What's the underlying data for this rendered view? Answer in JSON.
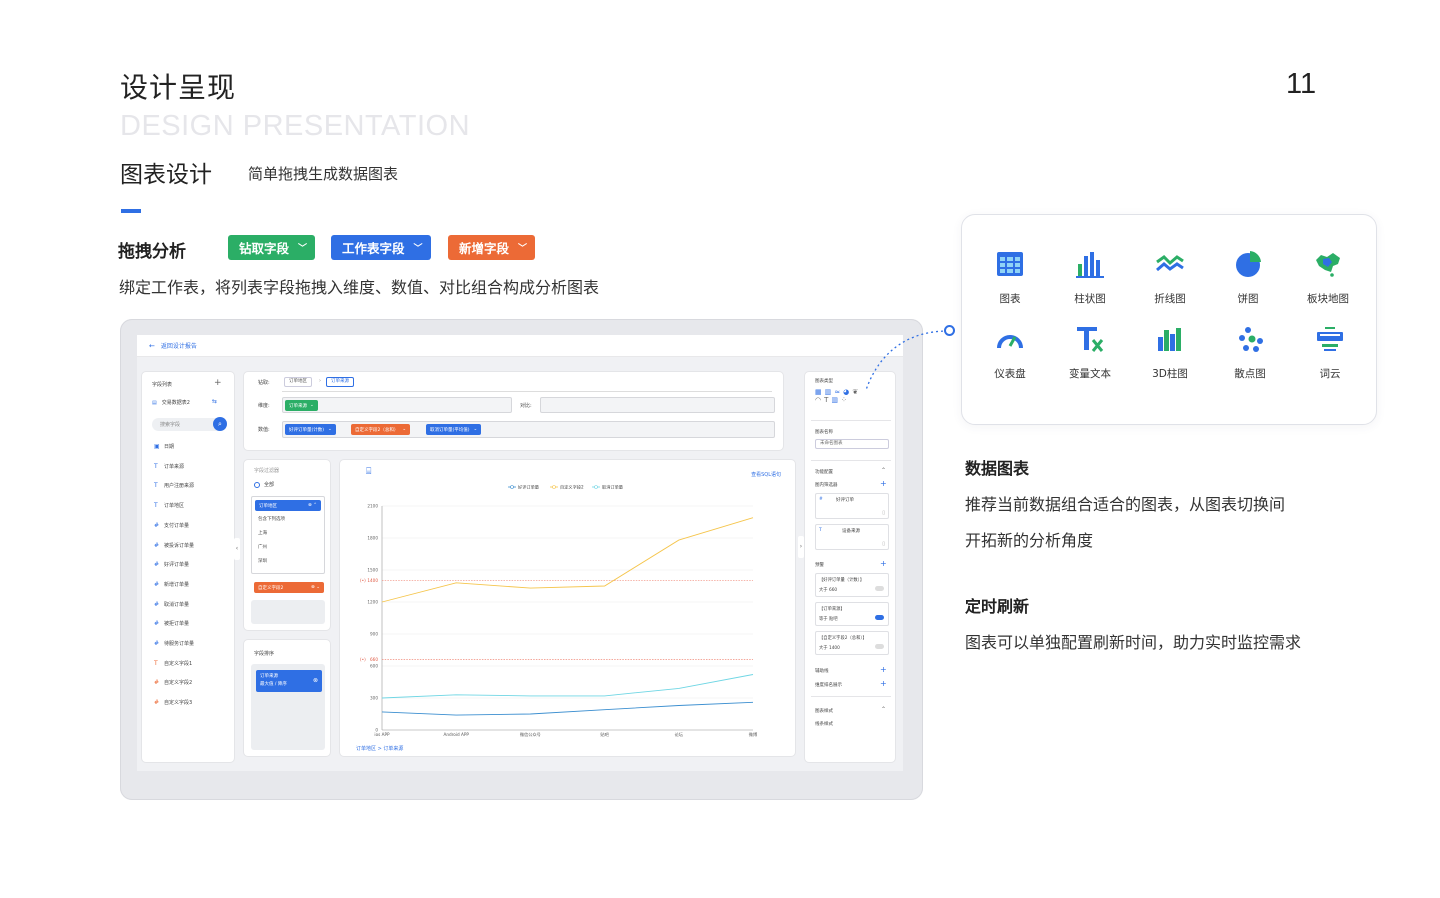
{
  "header": {
    "title_cn": "设计呈现",
    "title_en": "DESIGN PRESENTATION",
    "page_number": "11",
    "section_title": "图表设计",
    "section_subtitle": "简单拖拽生成数据图表"
  },
  "drag": {
    "title": "拖拽分析",
    "tags": [
      "钻取字段",
      "工作表字段",
      "新增字段"
    ],
    "description": "绑定工作表，将列表字段拖拽入维度、数值、对比组合构成分析图表"
  },
  "colors": {
    "accent": "#2f6fe4",
    "green": "#2bae66",
    "orange": "#ec6a36",
    "yellow": "#f5c54c",
    "cyan": "#6fd6e4",
    "blue_line": "#3c8fd0",
    "ref_line": "#f08a7a"
  },
  "mock": {
    "back_label": "返回设计报告",
    "field_list_title": "字段列表",
    "dataset_name": "交易数据表2",
    "search_placeholder": "搜索字段",
    "fields": [
      {
        "icon": "calendar-icon",
        "glyph": "▣",
        "label": "日期"
      },
      {
        "icon": "text-type-icon",
        "glyph": "T",
        "label": "订单来源"
      },
      {
        "icon": "text-type-icon",
        "glyph": "T",
        "label": "用户注册来源"
      },
      {
        "icon": "text-type-icon",
        "glyph": "T",
        "label": "订单地区"
      },
      {
        "icon": "number-type-icon",
        "glyph": "#",
        "label": "支付订单量"
      },
      {
        "icon": "number-type-icon",
        "glyph": "#",
        "label": "被投诉订单量"
      },
      {
        "icon": "number-type-icon",
        "glyph": "#",
        "label": "好评订单量"
      },
      {
        "icon": "number-type-icon",
        "glyph": "#",
        "label": "新增订单量"
      },
      {
        "icon": "number-type-icon",
        "glyph": "#",
        "label": "取消订单量"
      },
      {
        "icon": "number-type-icon",
        "glyph": "#",
        "label": "被拒订单量"
      },
      {
        "icon": "number-type-icon",
        "glyph": "#",
        "label": "待服务订单量"
      },
      {
        "icon": "custom-text-icon",
        "glyph": "T",
        "label": "自定义字段1"
      },
      {
        "icon": "custom-number-icon",
        "glyph": "#",
        "label": "自定义字段2"
      },
      {
        "icon": "custom-number-icon",
        "glyph": "#",
        "label": "自定义字段3"
      }
    ],
    "drill_label": "钻取:",
    "drill_items": [
      "订单地区",
      "订单来源"
    ],
    "dimension_label": "维度:",
    "dimension_value": "订单来源",
    "compare_label": "对比:",
    "value_label": "数值:",
    "value_pills": [
      "好评订单量(计数)",
      "自定义字段2（总和）",
      "取消订单量(平均值)"
    ],
    "filter_title": "字段过滤器",
    "filter_all": "全部",
    "filter_region": "订单地区",
    "filter_options": [
      "包含下列选项",
      "上海",
      "广州",
      "深圳"
    ],
    "filter_custom": "自定义字段2",
    "sort_title": "字段排序",
    "sort_field": "订单来源",
    "sort_rule": "最大值 / 降序",
    "sql_link": "查看SQL语句",
    "breadcrumb": "订单地区 > 订单来源",
    "right_panel": {
      "chart_type": "图表类型",
      "chart_name": "图表名称",
      "chart_name_value": "未命名图表",
      "func_config": "功能配置",
      "inner_filter": "图内筛选器",
      "filter1": "好评订单",
      "filter2": "设备来源",
      "alert": "预警",
      "alert1_field": "【好评订单量（计数）】",
      "alert1_cond": "大于 660",
      "alert2_field": "【订单来源】",
      "alert2_cond": "等于 贴吧",
      "alert3_field": "【自定义字段2（总和）】",
      "alert3_cond": "大于 1400",
      "aux_line": "辅助线",
      "dim_rank": "维度排名展示",
      "chart_style": "图表样式",
      "line_style": "线条样式"
    }
  },
  "chart_data": {
    "type": "line",
    "categories": [
      "ios APP",
      "Android APP",
      "微信公众号",
      "贴吧",
      "论坛",
      "微博"
    ],
    "series": [
      {
        "name": "好评订单量",
        "values": [
          170,
          140,
          150,
          190,
          230,
          260
        ]
      },
      {
        "name": "自定义字段2",
        "values": [
          1200,
          1380,
          1330,
          1350,
          1780,
          1990
        ]
      },
      {
        "name": "取消订单量",
        "values": [
          300,
          330,
          320,
          320,
          390,
          520
        ]
      }
    ],
    "ref_lines": [
      {
        "label": "1400",
        "value": 1400
      },
      {
        "label": "660",
        "value": 660
      }
    ],
    "y_ticks": [
      0,
      300,
      600,
      900,
      1200,
      1500,
      1800,
      2100
    ],
    "ylim": [
      0,
      2100
    ]
  },
  "chart_types": [
    {
      "icon": "table-chart-icon",
      "label": "图表"
    },
    {
      "icon": "bar-chart-icon",
      "label": "柱状图"
    },
    {
      "icon": "line-chart-icon",
      "label": "折线图"
    },
    {
      "icon": "pie-chart-icon",
      "label": "饼图"
    },
    {
      "icon": "region-map-icon",
      "label": "板块地图"
    },
    {
      "icon": "gauge-icon",
      "label": "仪表盘"
    },
    {
      "icon": "variable-text-icon",
      "label": "变量文本"
    },
    {
      "icon": "3d-bar-icon",
      "label": "3D柱图"
    },
    {
      "icon": "scatter-icon",
      "label": "散点图"
    },
    {
      "icon": "word-cloud-icon",
      "label": "词云"
    }
  ],
  "right_text": {
    "h1": "数据图表",
    "p1_line1": "推荐当前数据组合适合的图表，从图表切换间",
    "p1_line2": "开拓新的分析角度",
    "h2": "定时刷新",
    "p2": "图表可以单独配置刷新时间，助力实时监控需求"
  }
}
